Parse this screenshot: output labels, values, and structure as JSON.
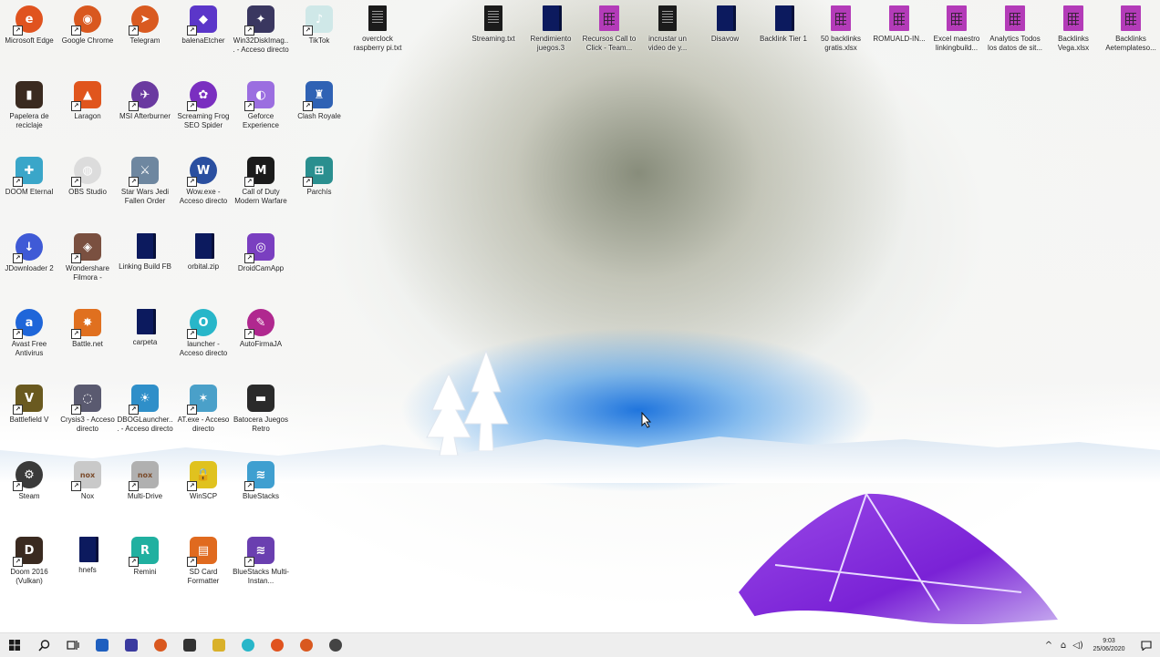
{
  "desktop_icons": [
    {
      "label": "Microsoft Edge",
      "glyph": "e",
      "color": "#e0531f",
      "shape": "round",
      "shortcut": true
    },
    {
      "label": "Google Chrome",
      "glyph": "◉",
      "color": "#d9581f",
      "shape": "round",
      "shortcut": true
    },
    {
      "label": "Telegram",
      "glyph": "➤",
      "color": "#d95a20",
      "shape": "round",
      "shortcut": true
    },
    {
      "label": "balenaEtcher",
      "glyph": "◆",
      "color": "#5b36c9",
      "shape": "",
      "shortcut": true
    },
    {
      "label": "Win32DiskImag... - Acceso directo",
      "glyph": "✦",
      "color": "#3a3760",
      "shape": "",
      "shortcut": true
    },
    {
      "label": "TikTok",
      "glyph": "♪",
      "color": "#cfe8e8",
      "shape": "",
      "shortcut": true
    },
    {
      "label": "overclock raspberry pi.txt",
      "glyph": "",
      "color": "#1b1b1b",
      "shape": "doc",
      "shortcut": false
    },
    {
      "label": "Streaming.txt",
      "glyph": "",
      "color": "#1b1b1b",
      "shape": "doc",
      "shortcut": false
    },
    {
      "label": "Rendimiento juegos.3",
      "glyph": "",
      "color": "#0c1a5e",
      "shape": "book",
      "shortcut": false
    },
    {
      "label": "Recursos Call to Click - Team...",
      "glyph": "",
      "color": "#b33bb8",
      "shape": "sheet",
      "shortcut": false
    },
    {
      "label": "incrustar un video de y...",
      "glyph": "",
      "color": "#1b1b1b",
      "shape": "doc",
      "shortcut": false
    },
    {
      "label": "Disavow",
      "glyph": "",
      "color": "#0c1a5e",
      "shape": "book",
      "shortcut": false
    },
    {
      "label": "Backlink Tier 1",
      "glyph": "",
      "color": "#0c1a5e",
      "shape": "book",
      "shortcut": false
    },
    {
      "label": "50 backlinks gratis.xlsx",
      "glyph": "",
      "color": "#b33bb8",
      "shape": "sheet",
      "shortcut": false
    },
    {
      "label": "ROMUALD-IN...",
      "glyph": "",
      "color": "#b33bb8",
      "shape": "sheet",
      "shortcut": false
    },
    {
      "label": "Excel maestro linkingbuild...",
      "glyph": "",
      "color": "#b33bb8",
      "shape": "sheet",
      "shortcut": false
    },
    {
      "label": "Analytics Todos los datos de sit...",
      "glyph": "",
      "color": "#b33bb8",
      "shape": "sheet",
      "shortcut": false
    },
    {
      "label": "Backlinks Vega.xlsx",
      "glyph": "",
      "color": "#b33bb8",
      "shape": "sheet",
      "shortcut": false
    },
    {
      "label": "Backlinks Aetemplateso...",
      "glyph": "",
      "color": "#b33bb8",
      "shape": "sheet",
      "shortcut": false
    },
    {
      "label": "Papelera de reciclaje",
      "glyph": "▮",
      "color": "#3a2a20",
      "shape": "",
      "shortcut": false
    },
    {
      "label": "Laragon",
      "glyph": "▲",
      "color": "#e0551d",
      "shape": "",
      "shortcut": true
    },
    {
      "label": "MSI Afterburner",
      "glyph": "✈",
      "color": "#6a3aa0",
      "shape": "round",
      "shortcut": true
    },
    {
      "label": "Screaming Frog SEO Spider",
      "glyph": "✿",
      "color": "#7a2fc0",
      "shape": "round",
      "shortcut": true
    },
    {
      "label": "Geforce Experience",
      "glyph": "◐",
      "color": "#9b6ee0",
      "shape": "",
      "shortcut": true
    },
    {
      "label": "Clash Royale",
      "glyph": "♜",
      "color": "#2f62b4",
      "shape": "",
      "shortcut": true
    },
    {
      "label": "DOOM Eternal",
      "glyph": "✚",
      "color": "#3aa6c9",
      "shape": "",
      "shortcut": true
    },
    {
      "label": "OBS Studio",
      "glyph": "◍",
      "color": "#dcdcdc",
      "shape": "round",
      "shortcut": true
    },
    {
      "label": "Star Wars Jedi Fallen Order",
      "glyph": "⚔",
      "color": "#6e87a0",
      "shape": "",
      "shortcut": true
    },
    {
      "label": "Wow.exe - Acceso directo",
      "glyph": "W",
      "color": "#2a4fa0",
      "shape": "round",
      "shortcut": true
    },
    {
      "label": "Call of Duty Modern Warfare",
      "glyph": "M",
      "color": "#1b1b1b",
      "shape": "",
      "shortcut": true
    },
    {
      "label": "Parchís",
      "glyph": "⊞",
      "color": "#2a8f8f",
      "shape": "",
      "shortcut": true
    },
    {
      "label": "JDownloader 2",
      "glyph": "↓",
      "color": "#3f5ad6",
      "shape": "round",
      "shortcut": true
    },
    {
      "label": "Wondershare Filmora -",
      "glyph": "◈",
      "color": "#7a5040",
      "shape": "",
      "shortcut": true
    },
    {
      "label": "Linking Build FB",
      "glyph": "",
      "color": "#0c1a5e",
      "shape": "book",
      "shortcut": false
    },
    {
      "label": "orbital.zip",
      "glyph": "",
      "color": "#0c1a5e",
      "shape": "book",
      "shortcut": false
    },
    {
      "label": "DroidCamApp",
      "glyph": "◎",
      "color": "#7a3fc0",
      "shape": "",
      "shortcut": true
    },
    {
      "label": "Avast Free Antivirus",
      "glyph": "a",
      "color": "#1f66d9",
      "shape": "round",
      "shortcut": true
    },
    {
      "label": "Battle.net",
      "glyph": "✸",
      "color": "#e0701f",
      "shape": "",
      "shortcut": true
    },
    {
      "label": "carpeta",
      "glyph": "",
      "color": "#0c1a5e",
      "shape": "book",
      "shortcut": false
    },
    {
      "label": "launcher - Acceso directo",
      "glyph": "O",
      "color": "#28b6c9",
      "shape": "round",
      "shortcut": true
    },
    {
      "label": "AutoFirmaJA",
      "glyph": "✎",
      "color": "#b0288f",
      "shape": "round",
      "shortcut": true
    },
    {
      "label": "Battlefield V",
      "glyph": "V",
      "color": "#6a5a20",
      "shape": "",
      "shortcut": true
    },
    {
      "label": "Crysis3 - Acceso directo",
      "glyph": "◌",
      "color": "#5a5a70",
      "shape": "",
      "shortcut": true
    },
    {
      "label": "DBOGLauncher... - Acceso directo",
      "glyph": "☀",
      "color": "#2f8fc9",
      "shape": "",
      "shortcut": true
    },
    {
      "label": "AT.exe - Acceso directo",
      "glyph": "✶",
      "color": "#4aa0c9",
      "shape": "",
      "shortcut": true
    },
    {
      "label": "Batocera Juegos Retro",
      "glyph": "▬",
      "color": "#2a2a2a",
      "shape": "",
      "shortcut": false
    },
    {
      "label": "Steam",
      "glyph": "⚙",
      "color": "#3a3a3a",
      "shape": "round",
      "shortcut": true
    },
    {
      "label": "Nox",
      "glyph": "nox",
      "color": "#c9c9c9",
      "shape": "",
      "shortcut": true
    },
    {
      "label": "Multi-Drive",
      "glyph": "nox",
      "color": "#b0b0b0",
      "shape": "",
      "shortcut": true
    },
    {
      "label": "WinSCP",
      "glyph": "🔒",
      "color": "#e0c21f",
      "shape": "",
      "shortcut": true
    },
    {
      "label": "BlueStacks",
      "glyph": "≋",
      "color": "#3f9fd0",
      "shape": "",
      "shortcut": true
    },
    {
      "label": "Doom 2016 (Vulkan)",
      "glyph": "D",
      "color": "#3a2a20",
      "shape": "",
      "shortcut": true
    },
    {
      "label": "hnefs",
      "glyph": "",
      "color": "#0c1a5e",
      "shape": "book",
      "shortcut": false
    },
    {
      "label": "Remini",
      "glyph": "R",
      "color": "#20b0a0",
      "shape": "",
      "shortcut": true
    },
    {
      "label": "SD Card Formatter",
      "glyph": "▤",
      "color": "#e06a1f",
      "shape": "",
      "shortcut": true
    },
    {
      "label": "BlueStacks Multi-Instan...",
      "glyph": "≋",
      "color": "#6a3fb0",
      "shape": "",
      "shortcut": true
    }
  ],
  "taskbar": {
    "start_icon": "windows-logo-icon",
    "search_icon": "search-icon",
    "taskview_icon": "task-view-icon",
    "pinned_apps": [
      {
        "name": "file-explorer",
        "color": "#1f5fbf"
      },
      {
        "name": "microsoft-store",
        "color": "#3a3a9f"
      },
      {
        "name": "chrome",
        "color": "#d9581f"
      },
      {
        "name": "app-dark",
        "color": "#333333"
      },
      {
        "name": "folder",
        "color": "#d9b12a"
      },
      {
        "name": "cortana-circle",
        "color": "#28b6c9"
      },
      {
        "name": "edge",
        "color": "#e0531f"
      },
      {
        "name": "chrome-alt",
        "color": "#d9581f"
      },
      {
        "name": "obs",
        "color": "#444444"
      }
    ],
    "tray": {
      "chevron": "^",
      "network": "⌂",
      "speaker": "◁)",
      "time": "9:03",
      "date": "25/06/2020"
    }
  },
  "wallpaper": {
    "accent_blue": "#1e73d6",
    "tent_purple": "#7a22d6"
  }
}
